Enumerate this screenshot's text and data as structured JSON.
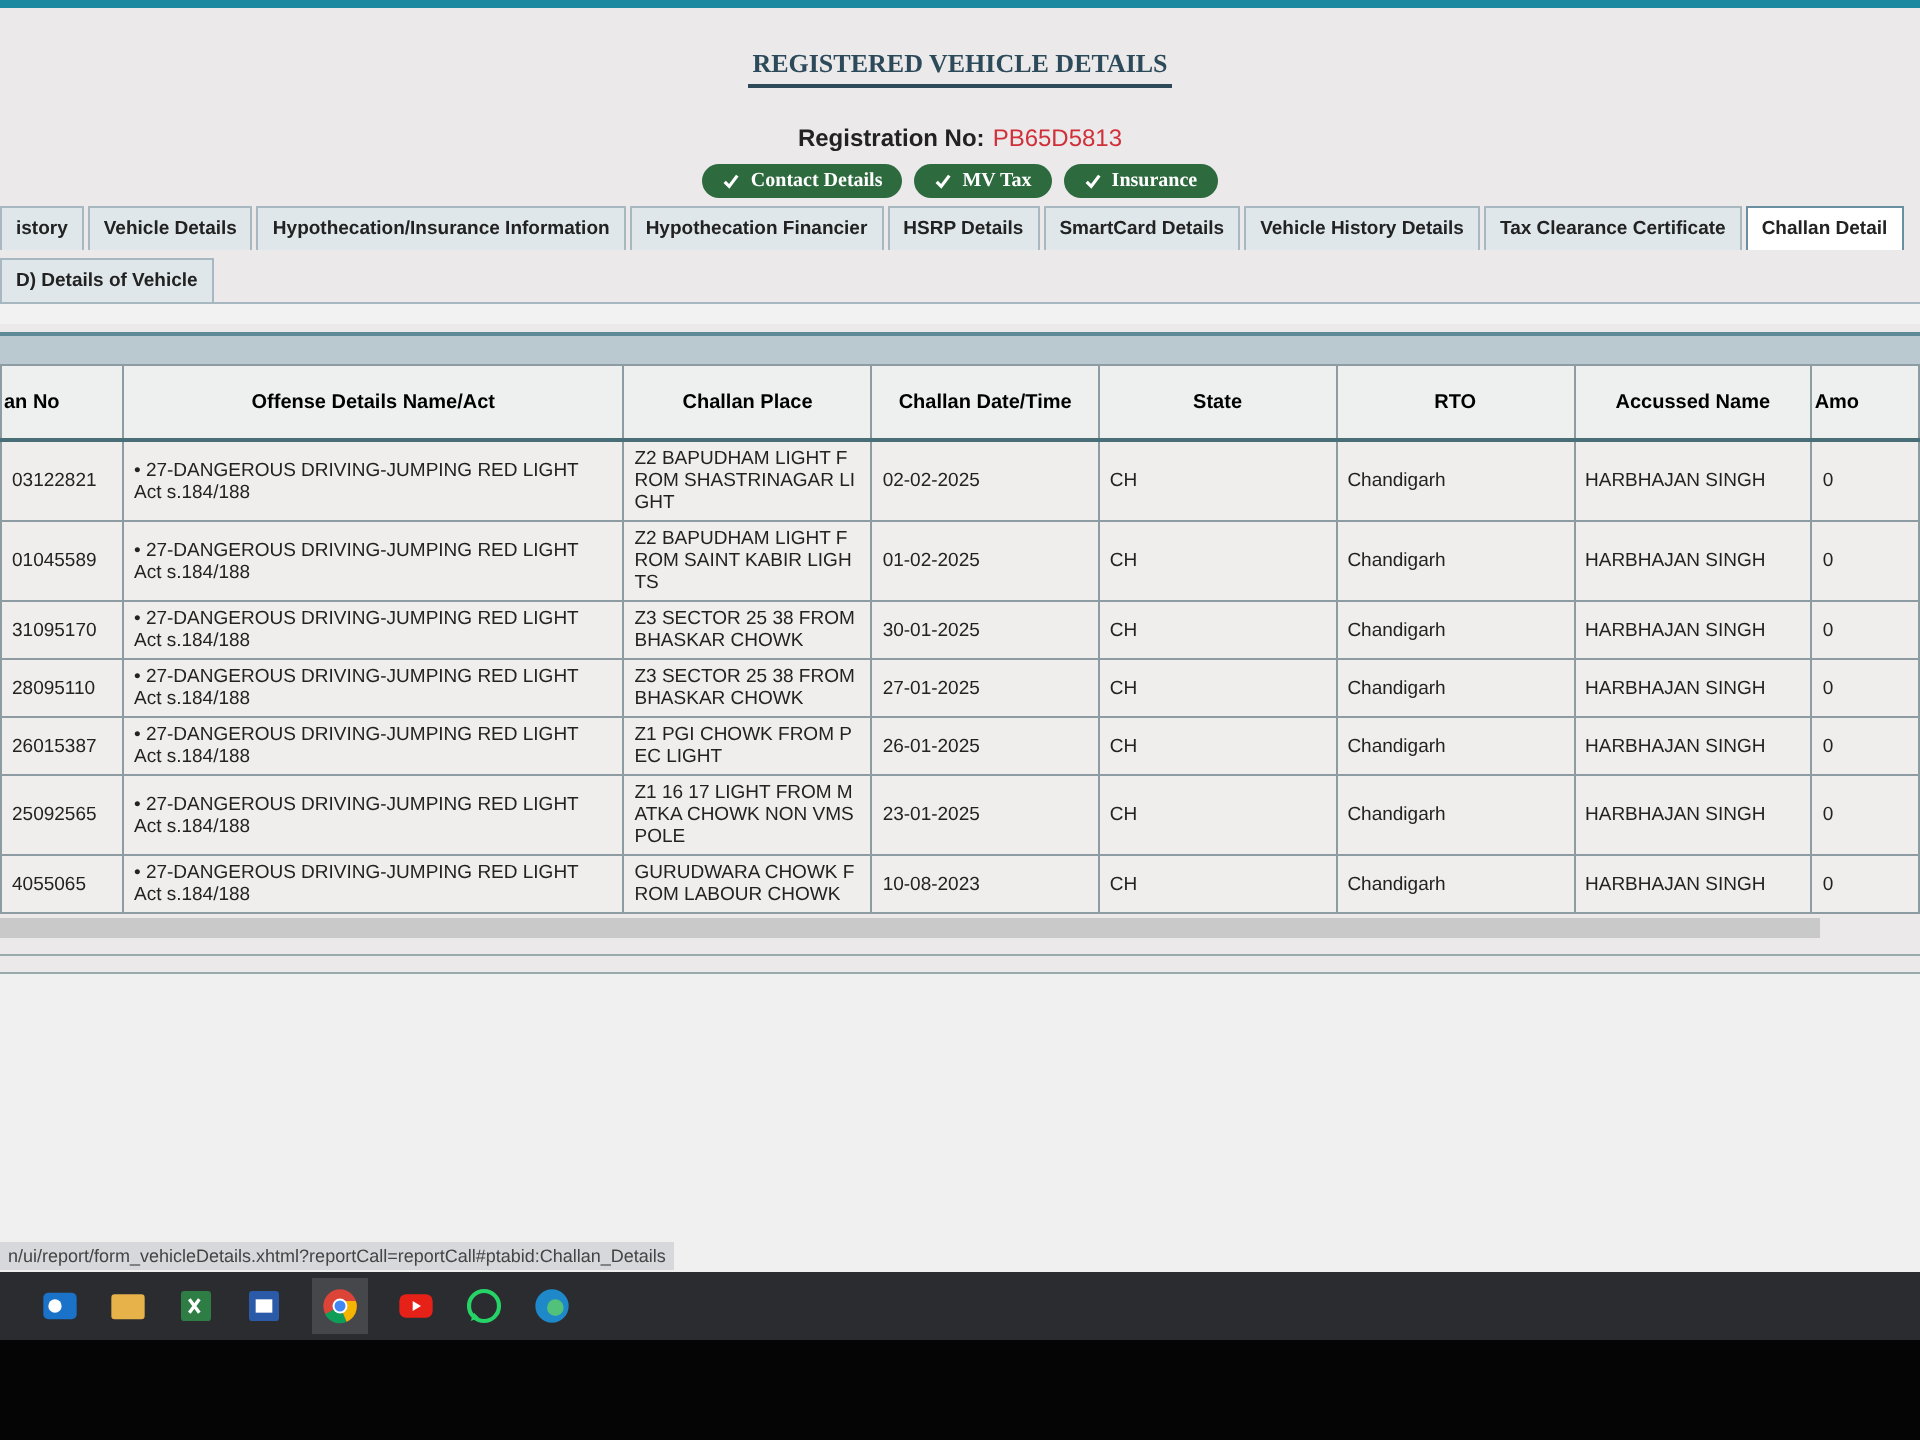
{
  "page": {
    "title": "REGISTERED VEHICLE DETAILS",
    "registration_label": "Registration No:",
    "registration_value": "PB65D5813"
  },
  "status_buttons": [
    {
      "label": "Contact Details"
    },
    {
      "label": "MV Tax"
    },
    {
      "label": "Insurance"
    }
  ],
  "tabs_row_1": [
    {
      "label": "istory",
      "selected": false
    },
    {
      "label": "Vehicle Details",
      "selected": false
    },
    {
      "label": "Hypothecation/Insurance Information",
      "selected": false
    },
    {
      "label": "Hypothecation Financier",
      "selected": false
    },
    {
      "label": "HSRP Details",
      "selected": false
    },
    {
      "label": "SmartCard Details",
      "selected": false
    },
    {
      "label": "Vehicle History Details",
      "selected": false
    },
    {
      "label": "Tax Clearance Certificate",
      "selected": false
    },
    {
      "label": "Challan Detail",
      "selected": true
    }
  ],
  "tabs_row_2": [
    {
      "label": "D) Details of Vehicle",
      "selected": false
    }
  ],
  "table": {
    "columns": [
      "an No",
      "Offense Details Name/Act",
      "Challan Place",
      "Challan Date/Time",
      "State",
      "RTO",
      "Accussed Name",
      "Amo"
    ],
    "rows": [
      {
        "challan_no": "03122821",
        "offense": "• 27-DANGEROUS DRIVING-JUMPING RED LIGHT",
        "act": "Act s.184/188",
        "place": "Z2 BAPUDHAM LIGHT FROM SHASTRINAGAR LIGHT",
        "date": "02-02-2025",
        "state": "CH",
        "rto": "Chandigarh",
        "accused": "HARBHAJAN SINGH",
        "amount": "0"
      },
      {
        "challan_no": "01045589",
        "offense": "• 27-DANGEROUS DRIVING-JUMPING RED LIGHT",
        "act": "Act s.184/188",
        "place": "Z2 BAPUDHAM LIGHT FROM SAINT KABIR LIGHTS",
        "date": "01-02-2025",
        "state": "CH",
        "rto": "Chandigarh",
        "accused": "HARBHAJAN SINGH",
        "amount": "0"
      },
      {
        "challan_no": "31095170",
        "offense": "• 27-DANGEROUS DRIVING-JUMPING RED LIGHT",
        "act": "Act s.184/188",
        "place": "Z3 SECTOR 25 38 FROM BHASKAR CHOWK",
        "date": "30-01-2025",
        "state": "CH",
        "rto": "Chandigarh",
        "accused": "HARBHAJAN SINGH",
        "amount": "0"
      },
      {
        "challan_no": "28095110",
        "offense": "• 27-DANGEROUS DRIVING-JUMPING RED LIGHT",
        "act": "Act s.184/188",
        "place": "Z3 SECTOR 25 38 FROM BHASKAR CHOWK",
        "date": "27-01-2025",
        "state": "CH",
        "rto": "Chandigarh",
        "accused": "HARBHAJAN SINGH",
        "amount": "0"
      },
      {
        "challan_no": "26015387",
        "offense": "• 27-DANGEROUS DRIVING-JUMPING RED LIGHT",
        "act": "Act s.184/188",
        "place": "Z1 PGI CHOWK FROM PEC LIGHT",
        "date": "26-01-2025",
        "state": "CH",
        "rto": "Chandigarh",
        "accused": "HARBHAJAN SINGH",
        "amount": "0"
      },
      {
        "challan_no": "25092565",
        "offense": "• 27-DANGEROUS DRIVING-JUMPING RED LIGHT",
        "act": "Act s.184/188",
        "place": "Z1 16 17 LIGHT FROM MATKA CHOWK NON VMS POLE",
        "date": "23-01-2025",
        "state": "CH",
        "rto": "Chandigarh",
        "accused": "HARBHAJAN SINGH",
        "amount": "0"
      },
      {
        "challan_no": "4055065",
        "offense": "• 27-DANGEROUS DRIVING-JUMPING RED LIGHT",
        "act": "Act s.184/188",
        "place": "GURUDWARA CHOWK FROM LABOUR CHOWK",
        "date": "10-08-2023",
        "state": "CH",
        "rto": "Chandigarh",
        "accused": "HARBHAJAN SINGH",
        "amount": "0"
      }
    ]
  },
  "status_bar": {
    "url": "n/ui/report/form_vehicleDetails.xhtml?reportCall=reportCall#ptabid:Challan_Details"
  }
}
